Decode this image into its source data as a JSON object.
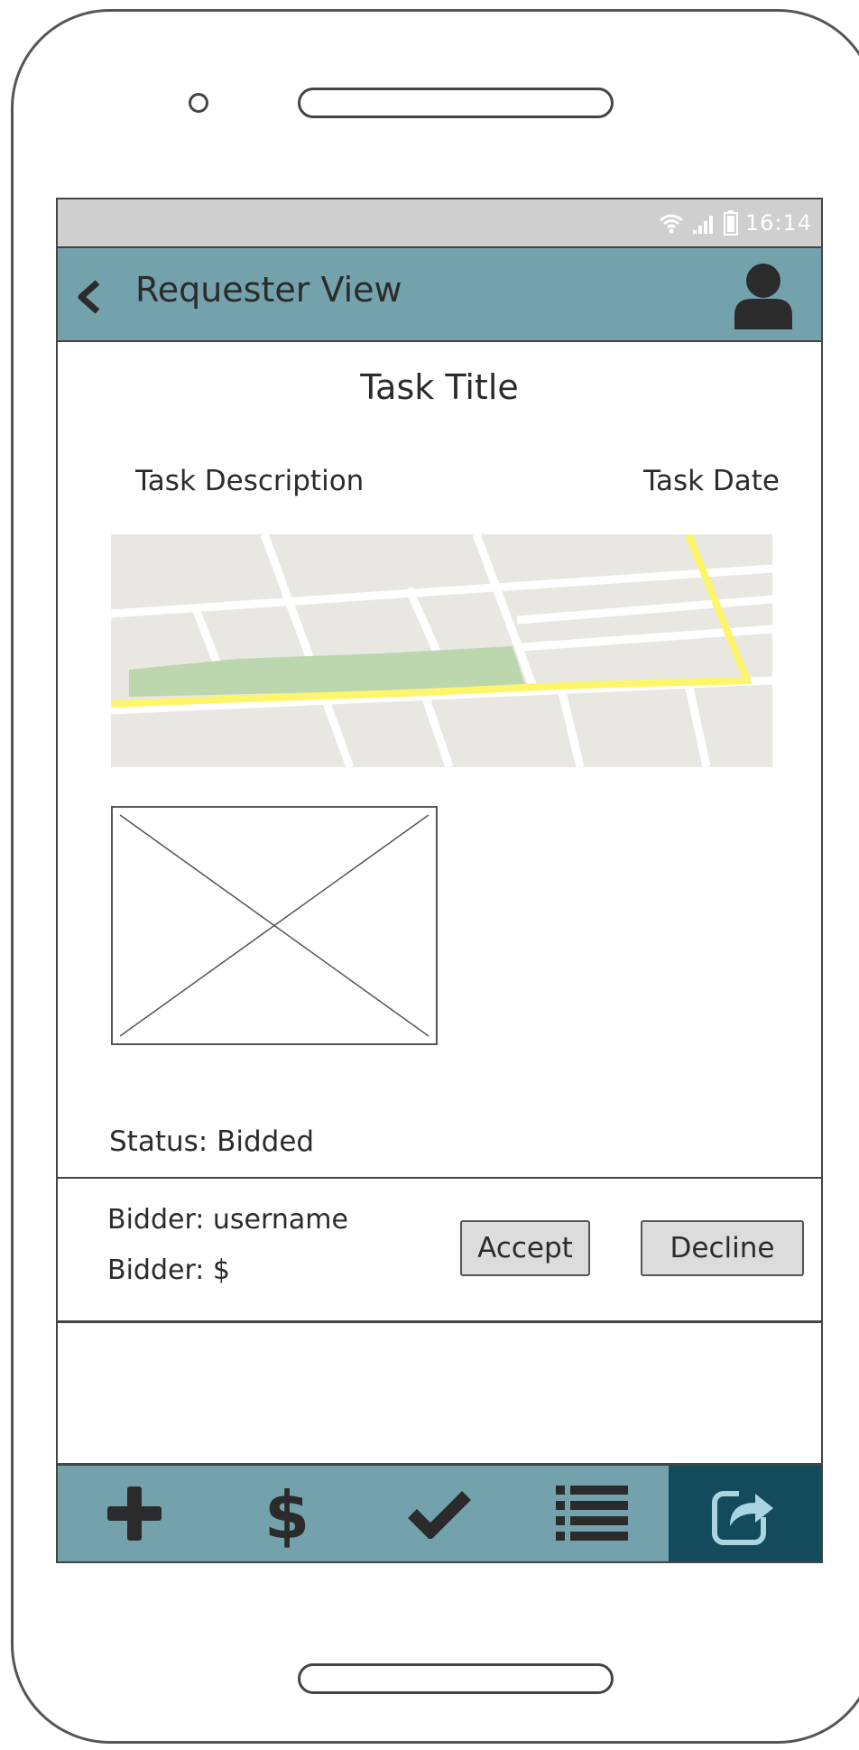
{
  "status_bar": {
    "time": "16:14"
  },
  "app_bar": {
    "title": "Requester View",
    "back_icon": "chevron-left-icon",
    "profile_icon": "user-icon"
  },
  "task": {
    "title": "Task Title",
    "description": "Task Description",
    "date": "Task Date",
    "status": "Status: Bidded"
  },
  "bid": {
    "bidder_name": "Bidder: username",
    "bidder_amount": "Bidder: $",
    "accept_label": "Accept",
    "decline_label": "Decline"
  },
  "bottom_nav": {
    "items": [
      "plus-icon",
      "dollar-icon",
      "check-icon",
      "list-icon",
      "share-icon"
    ],
    "active_item": "share-icon"
  },
  "colors": {
    "app_bar": "#73a2ad",
    "active_nav": "#134b5c",
    "status_bar": "#cfcfcf",
    "route": "#fdf56a",
    "park": "#bcd6ad"
  }
}
